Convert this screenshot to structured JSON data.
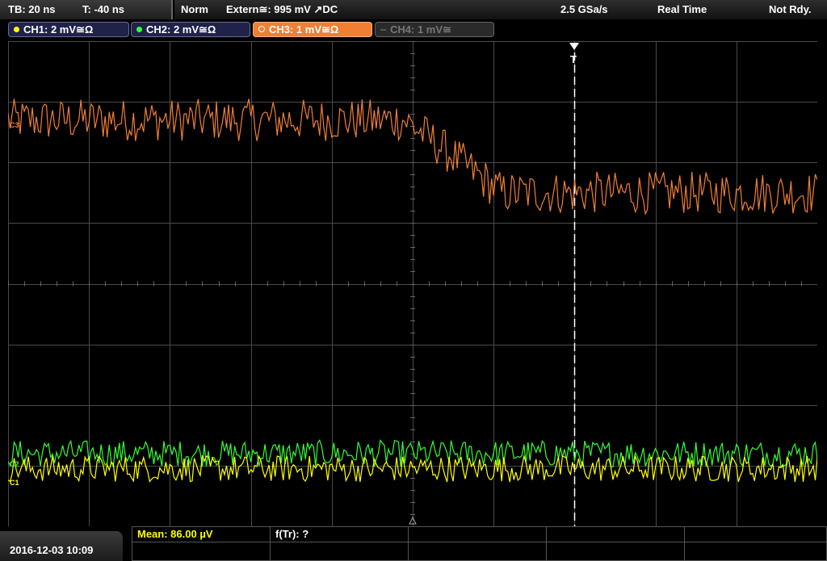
{
  "header": {
    "timebase": "TB: 20 ns",
    "trigger_time": "T: -40 ns",
    "mode": "Norm",
    "trigger_source": "Extern≅: 995 mV ↗DC",
    "sample_rate": "2.5 GSa/s",
    "acq_mode": "Real Time",
    "status": "Not Rdy."
  },
  "channels": [
    {
      "label": "CH1: 2 mV≅Ω",
      "color": "#ffff00"
    },
    {
      "label": "CH2: 2 mV≅Ω",
      "color": "#33ff33"
    },
    {
      "label": "CH3: 1 mV≅Ω",
      "color": "#f07f34"
    },
    {
      "label": "CH4: 1 mV≅",
      "color": "#777777"
    }
  ],
  "markers": {
    "ch3": "C3",
    "ch2": "C2",
    "ch1": "C1",
    "trigger": "T"
  },
  "footer": {
    "datetime": "2016-12-03 10:09",
    "mean": "Mean: 86.00 µV",
    "ftr": "f(Tr): ?"
  },
  "colors": {
    "grid": "#4a4a4a",
    "ch1": "#ffff00",
    "ch2": "#33ff33",
    "ch3": "#f07f34",
    "trigger": "#ffffff"
  },
  "chart_data": {
    "type": "line",
    "grid": true,
    "divisions_x": 10,
    "divisions_y": 8,
    "series": [
      {
        "name": "CH3",
        "level_start_div": 2.7,
        "level_end_div": 1.5,
        "step_at_div": 5.5,
        "noise_div": 0.35
      },
      {
        "name": "CH2",
        "level_start_div": -2.8,
        "level_end_div": -2.8,
        "noise_div": 0.22
      },
      {
        "name": "CH1",
        "level_start_div": -3.05,
        "level_end_div": -3.05,
        "noise_div": 0.22
      }
    ],
    "trigger_x_div": 7.0
  }
}
